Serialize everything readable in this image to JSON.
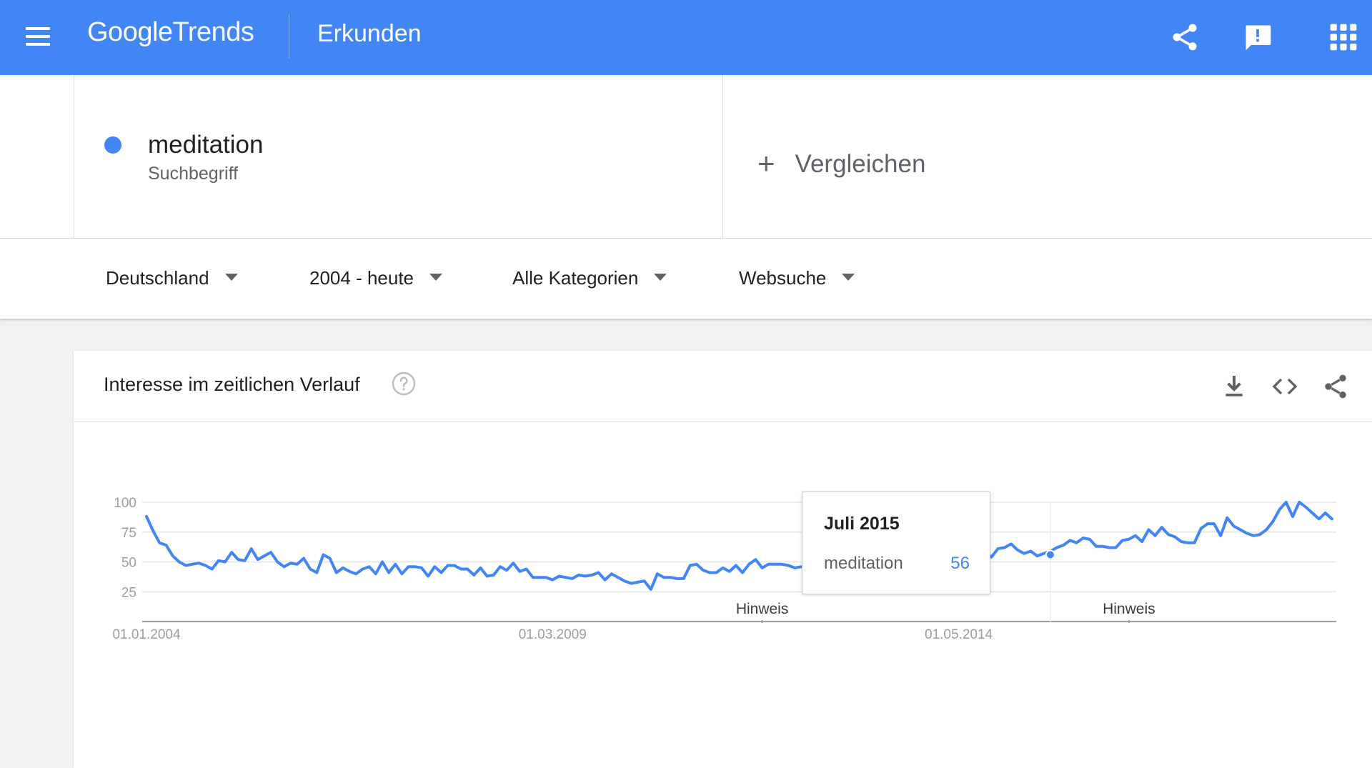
{
  "header": {
    "logo_google": "Google",
    "logo_trends": "Trends",
    "page_title": "Erkunden"
  },
  "term": {
    "name": "meditation",
    "type": "Suchbegriff",
    "color": "#4285f4"
  },
  "compare": {
    "label": "Vergleichen",
    "plus": "+"
  },
  "filters": [
    "Deutschland",
    "2004 - heute",
    "Alle Kategorien",
    "Websuche"
  ],
  "card": {
    "title": "Interesse im zeitlichen Verlauf"
  },
  "tooltip": {
    "date": "Juli 2015",
    "term": "meditation",
    "value": "56"
  },
  "icons": {
    "menu": "menu-icon",
    "share": "share-icon",
    "feedback": "feedback-icon",
    "apps": "apps-grid-icon",
    "help": "help-icon",
    "download": "download-icon",
    "embed": "embed-code-icon",
    "card_share": "share-icon"
  },
  "chart_data": {
    "type": "line",
    "title": "Interesse im zeitlichen Verlauf",
    "xlabel": "",
    "ylabel": "",
    "ylim": [
      0,
      100
    ],
    "yticks": [
      25,
      50,
      75,
      100
    ],
    "x_tick_labels": [
      "01.01.2004",
      "01.03.2009",
      "01.05.2014"
    ],
    "x_tick_dates": [
      "2004-01",
      "2009-03",
      "2014-05"
    ],
    "annotations": [
      {
        "label": "Hinweis",
        "date": "2011-11"
      },
      {
        "label": "Hinweis",
        "date": "2016-07"
      }
    ],
    "highlight": {
      "date": "2015-07",
      "value": 56
    },
    "legend": "none",
    "grid": true,
    "series": [
      {
        "name": "meditation",
        "color": "#4285f4",
        "start": "2004-01",
        "frequency": "monthly",
        "values": [
          88,
          76,
          66,
          64,
          55,
          50,
          47,
          48,
          49,
          47,
          44,
          51,
          50,
          58,
          52,
          51,
          61,
          52,
          55,
          58,
          50,
          46,
          49,
          48,
          53,
          44,
          41,
          56,
          53,
          41,
          45,
          42,
          40,
          44,
          46,
          40,
          50,
          41,
          48,
          40,
          46,
          46,
          45,
          38,
          46,
          41,
          47,
          47,
          44,
          44,
          39,
          45,
          38,
          39,
          46,
          43,
          49,
          42,
          44,
          37,
          37,
          37,
          35,
          38,
          37,
          36,
          39,
          38,
          39,
          41,
          35,
          40,
          37,
          34,
          32,
          33,
          34,
          27,
          40,
          37,
          37,
          36,
          36,
          47,
          48,
          43,
          41,
          41,
          45,
          42,
          47,
          41,
          48,
          52,
          45,
          48,
          48,
          48,
          47,
          45,
          46,
          46,
          43,
          46,
          48,
          49,
          50,
          51,
          48,
          51,
          49,
          52,
          52,
          47,
          47,
          50,
          53,
          55,
          56,
          58,
          60,
          56,
          52,
          55,
          56,
          50,
          52,
          55,
          59,
          54,
          61,
          62,
          65,
          60,
          57,
          59,
          55,
          57,
          59,
          62,
          64,
          68,
          66,
          70,
          69,
          63,
          63,
          62,
          62,
          68,
          69,
          72,
          67,
          77,
          72,
          79,
          73,
          71,
          67,
          66,
          66,
          78,
          82,
          82,
          72,
          87,
          80,
          77,
          74,
          72,
          73,
          77,
          84,
          94,
          100,
          88,
          100,
          96,
          91,
          86,
          91,
          86
        ]
      }
    ]
  }
}
